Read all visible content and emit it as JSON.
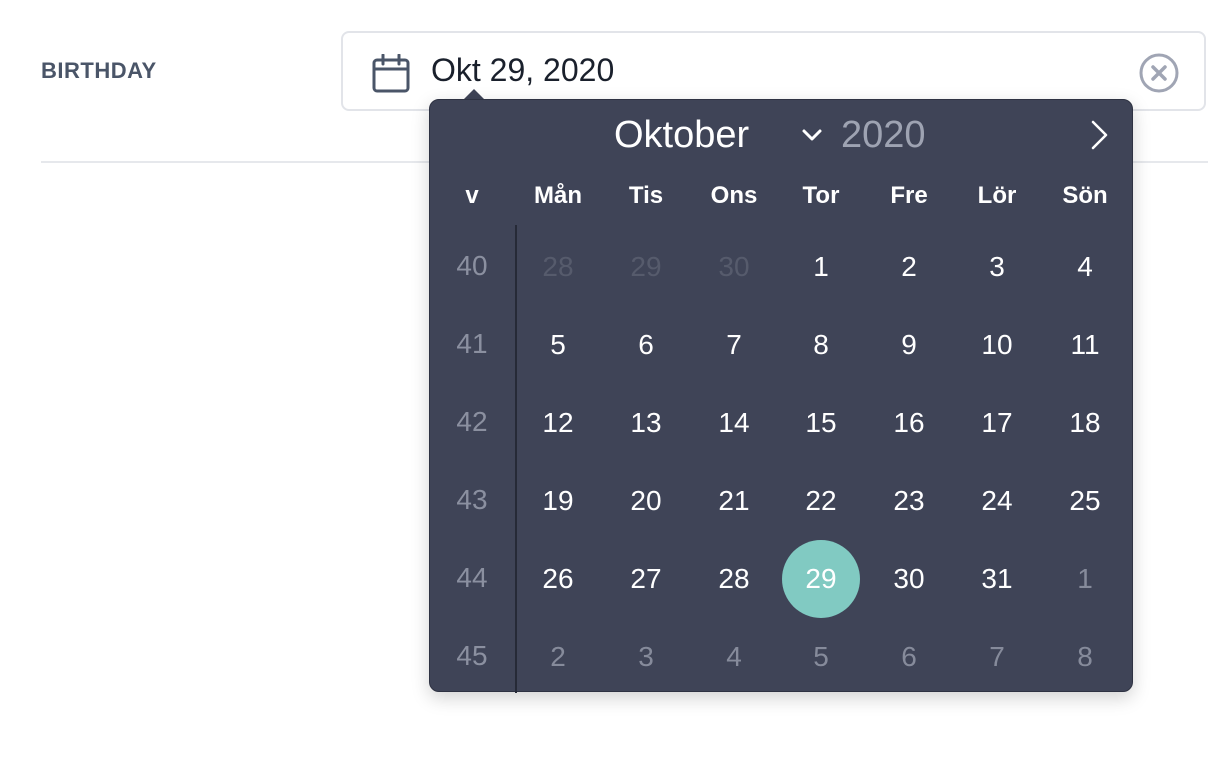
{
  "field": {
    "label": "BIRTHDAY",
    "value": "Okt 29, 2020",
    "calendar_icon": "calendar-icon",
    "clear_icon": "close-circle-icon"
  },
  "picker": {
    "month": "Oktober",
    "year": "2020",
    "week_header": "v",
    "weekdays": [
      "Mån",
      "Tis",
      "Ons",
      "Tor",
      "Fre",
      "Lör",
      "Sön"
    ],
    "weeks": [
      {
        "number": "40",
        "days": [
          {
            "d": "28",
            "s": "prev"
          },
          {
            "d": "29",
            "s": "prev"
          },
          {
            "d": "30",
            "s": "prev"
          },
          {
            "d": "1",
            "s": ""
          },
          {
            "d": "2",
            "s": ""
          },
          {
            "d": "3",
            "s": ""
          },
          {
            "d": "4",
            "s": ""
          }
        ]
      },
      {
        "number": "41",
        "days": [
          {
            "d": "5",
            "s": ""
          },
          {
            "d": "6",
            "s": ""
          },
          {
            "d": "7",
            "s": ""
          },
          {
            "d": "8",
            "s": ""
          },
          {
            "d": "9",
            "s": ""
          },
          {
            "d": "10",
            "s": ""
          },
          {
            "d": "11",
            "s": ""
          }
        ]
      },
      {
        "number": "42",
        "days": [
          {
            "d": "12",
            "s": ""
          },
          {
            "d": "13",
            "s": ""
          },
          {
            "d": "14",
            "s": ""
          },
          {
            "d": "15",
            "s": ""
          },
          {
            "d": "16",
            "s": ""
          },
          {
            "d": "17",
            "s": ""
          },
          {
            "d": "18",
            "s": ""
          }
        ]
      },
      {
        "number": "43",
        "days": [
          {
            "d": "19",
            "s": ""
          },
          {
            "d": "20",
            "s": ""
          },
          {
            "d": "21",
            "s": ""
          },
          {
            "d": "22",
            "s": ""
          },
          {
            "d": "23",
            "s": ""
          },
          {
            "d": "24",
            "s": ""
          },
          {
            "d": "25",
            "s": ""
          }
        ]
      },
      {
        "number": "44",
        "days": [
          {
            "d": "26",
            "s": ""
          },
          {
            "d": "27",
            "s": ""
          },
          {
            "d": "28",
            "s": ""
          },
          {
            "d": "29",
            "s": "selected"
          },
          {
            "d": "30",
            "s": ""
          },
          {
            "d": "31",
            "s": ""
          },
          {
            "d": "1",
            "s": "next"
          }
        ]
      },
      {
        "number": "45",
        "days": [
          {
            "d": "2",
            "s": "next"
          },
          {
            "d": "3",
            "s": "next"
          },
          {
            "d": "4",
            "s": "next"
          },
          {
            "d": "5",
            "s": "next"
          },
          {
            "d": "6",
            "s": "next"
          },
          {
            "d": "7",
            "s": "next"
          },
          {
            "d": "8",
            "s": "next"
          }
        ]
      }
    ],
    "colors": {
      "background": "#3f4457",
      "selected": "#81cac2",
      "muted_prev": "#565b6c",
      "muted_next": "#868b9b"
    },
    "icons": {
      "month_dropdown": "chevron-down-icon",
      "next": "chevron-right-icon"
    }
  }
}
